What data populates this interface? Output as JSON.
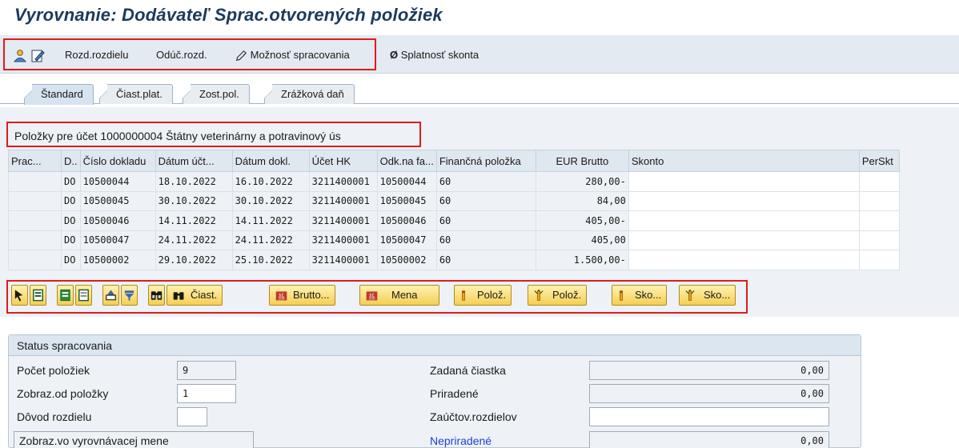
{
  "window": {
    "title": "Vyrovnanie: Dodávateľ Sprac.otvorených položiek"
  },
  "toolbar": {
    "diff_label": "Rozd.rozdielu",
    "deduct_label": "Odúč.rozd.",
    "options_label": "Možnosť spracovania",
    "discount_due_label": "Splatnosť skonta",
    "icons": [
      "person-icon",
      "edit-icon",
      "pencil-icon",
      "null-icon"
    ]
  },
  "tabs": [
    "Štandard",
    "Čiast.plat.",
    "Zost.pol.",
    "Zrážková daň"
  ],
  "section": {
    "title": "Položky pre účet 1000000004 Štátny veterinárny a potravinový ús"
  },
  "table": {
    "headers": [
      "Prac...",
      "D..",
      "Číslo dokladu",
      "Dátum účt...",
      "Dátum dokl.",
      "Účet HK",
      "Odk.na fa...",
      "Finančná položka",
      "EUR Brutto",
      "Skonto",
      "PerSkt"
    ],
    "rows": [
      [
        "",
        "DO",
        "10500044",
        "18.10.2022",
        "16.10.2022",
        "3211400001",
        "10500044",
        "60",
        "280,00-",
        "",
        ""
      ],
      [
        "",
        "DO",
        "10500045",
        "30.10.2022",
        "30.10.2022",
        "3211400001",
        "10500045",
        "60",
        "84,00",
        "",
        ""
      ],
      [
        "",
        "DO",
        "10500046",
        "14.11.2022",
        "14.11.2022",
        "3211400001",
        "10500046",
        "60",
        "405,00-",
        "",
        ""
      ],
      [
        "",
        "DO",
        "10500047",
        "24.11.2022",
        "24.11.2022",
        "3211400001",
        "10500047",
        "60",
        "405,00",
        "",
        ""
      ],
      [
        "",
        "DO",
        "10500002",
        "29.10.2022",
        "25.10.2022",
        "3211400001",
        "10500002",
        "60",
        "1.500,00-",
        "",
        ""
      ]
    ]
  },
  "alv": {
    "amount_label": "Čiast.",
    "gross_label": "Brutto...",
    "currency_label": "Mena",
    "items_label_1": "Polož.",
    "items_label_2": "Polož.",
    "discount_label_1": "Sko...",
    "discount_label_2": "Sko..."
  },
  "status": {
    "title": "Status spracovania",
    "count_label": "Počet položiek",
    "count_value": "9",
    "from_item_label": "Zobraz.od položky",
    "from_item_value": "1",
    "reason_label": "Dôvod rozdielu",
    "reason_value": "",
    "currency_toggle_label": "Zobraz.vo vyrovnávacej mene",
    "entered_label": "Zadaná čiastka",
    "entered_value": "0,00",
    "assigned_label": "Priradené",
    "assigned_value": "0,00",
    "posted_diff_label": "Zaúčtov.rozdielov",
    "posted_diff_value": "",
    "unassigned_label": "Nepriradené",
    "unassigned_value": "0,00"
  },
  "colors": {
    "highlight": "#e01b1b",
    "title": "#1b3a5c",
    "link": "#1f3fd6",
    "button": "#f4cf55"
  }
}
